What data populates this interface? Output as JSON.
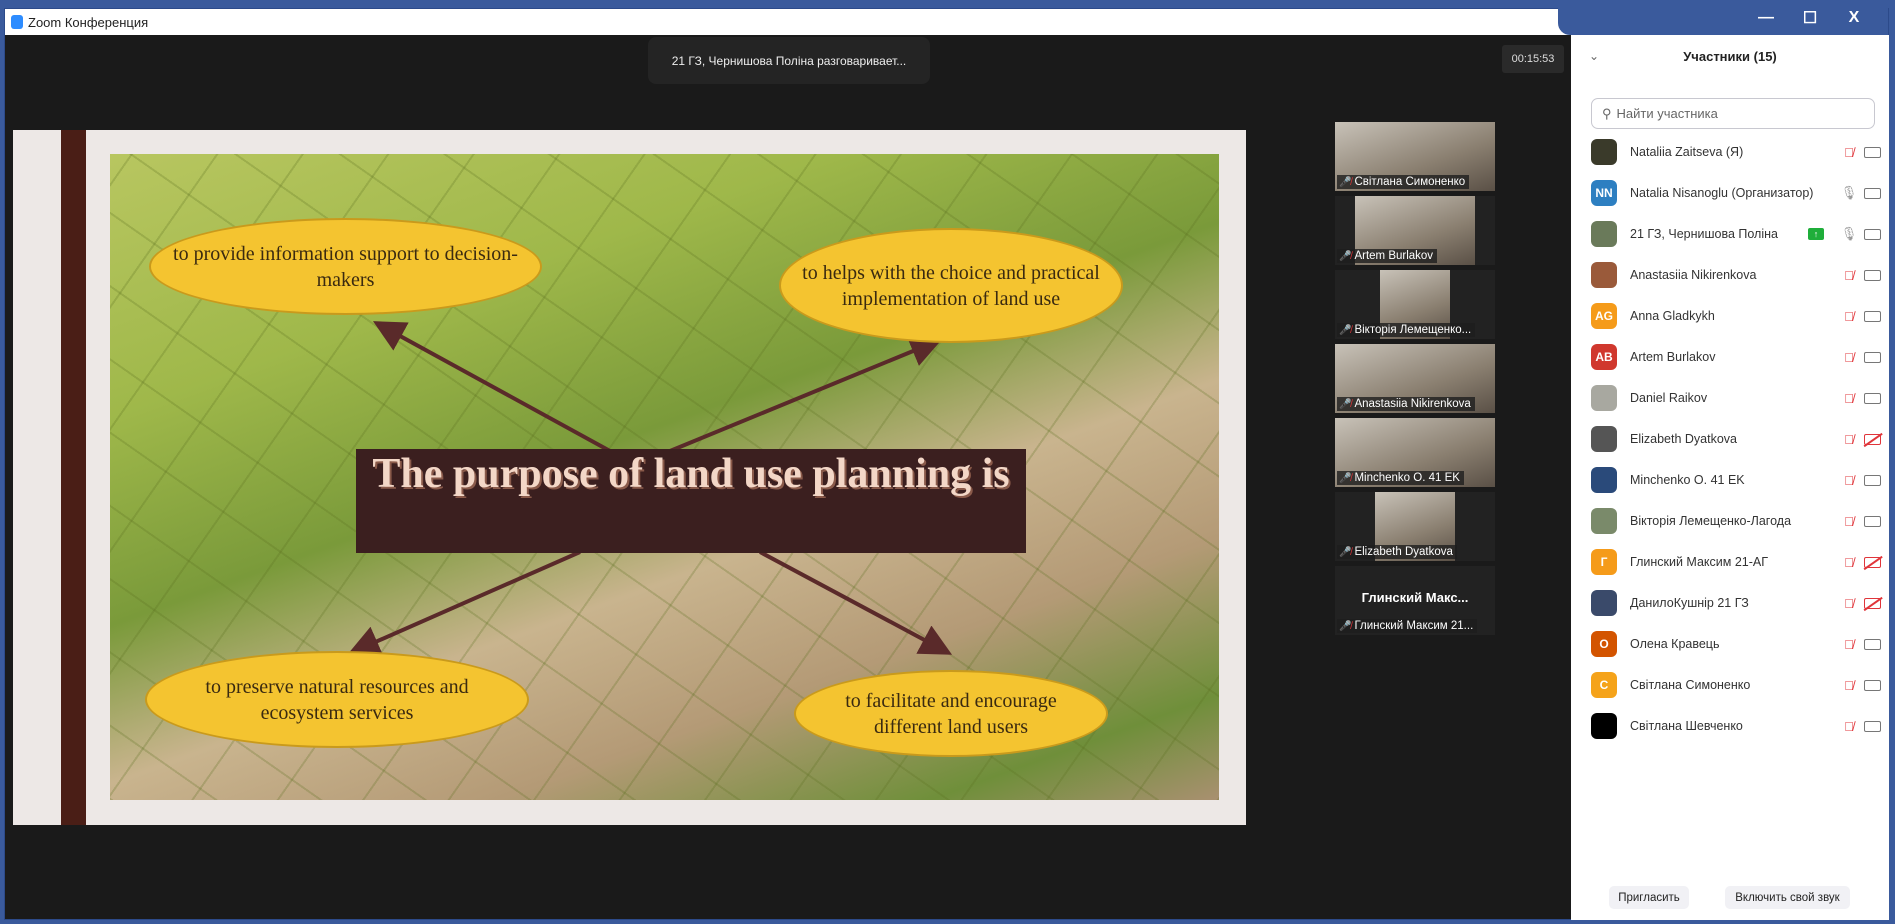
{
  "window": {
    "title": "Zoom Конференция",
    "minimize": "—",
    "maximize": "☐",
    "close": "X"
  },
  "meeting": {
    "speaking": "21 ГЗ, Чернишова Поліна разговаривает...",
    "timer": "00:15:53"
  },
  "slide": {
    "title": "The purpose of land use planning is",
    "bubbles": [
      "to provide information support to decision-makers",
      "to helps with the choice and practical implementation of land use",
      "to preserve natural resources and ecosystem services",
      "to facilitate and encourage different land users"
    ]
  },
  "videos": [
    {
      "name": "Світлана Симоненко"
    },
    {
      "name": "Artem Burlakov"
    },
    {
      "name": "Вікторія Лемещенко..."
    },
    {
      "name": "Anastasiia Nikirenkova"
    },
    {
      "name": "Minchenko O. 41 EK"
    },
    {
      "name": "Elizabeth Dyatkova"
    },
    {
      "name": "Глинский Максим 21...",
      "big": "Глинский  Макс..."
    }
  ],
  "panel": {
    "title": "Участники (15)",
    "search_placeholder": "Найти участника",
    "invite": "Пригласить",
    "unmute": "Включить свой звук",
    "participants": [
      {
        "name": "Nataliia Zaitseva (Я)",
        "initials": "",
        "color": "#3a3a2a",
        "mic": "off",
        "cam": "on"
      },
      {
        "name": "Natalia Nisanoglu (Организатор)",
        "initials": "NN",
        "color": "#2d7fc1",
        "mic": "on",
        "cam": "on"
      },
      {
        "name": "21 ГЗ, Чернишова Поліна",
        "initials": "",
        "color": "#6a7a5a",
        "mic": "on",
        "cam": "on",
        "sharing": true
      },
      {
        "name": "Anastasiia Nikirenkova",
        "initials": "",
        "color": "#9a5a3a",
        "mic": "off",
        "cam": "on"
      },
      {
        "name": "Anna Gladkykh",
        "initials": "AG",
        "color": "#f59b1a",
        "mic": "off",
        "cam": "on"
      },
      {
        "name": "Artem Burlakov",
        "initials": "AB",
        "color": "#d0382e",
        "mic": "off",
        "cam": "on"
      },
      {
        "name": "Daniel Raikov",
        "initials": "",
        "color": "#a8a8a0",
        "mic": "off",
        "cam": "on"
      },
      {
        "name": "Elizabeth Dyatkova",
        "initials": "",
        "color": "#555",
        "mic": "off",
        "cam": "off"
      },
      {
        "name": "Minchenko O. 41 EK",
        "initials": "",
        "color": "#2a4a7a",
        "mic": "off",
        "cam": "on"
      },
      {
        "name": "Вікторія Лемещенко-Лагода",
        "initials": "",
        "color": "#7a8a6a",
        "mic": "off",
        "cam": "on"
      },
      {
        "name": "Глинский Максим 21-АГ",
        "initials": "Г",
        "color": "#f59b1a",
        "mic": "off",
        "cam": "off"
      },
      {
        "name": "ДанилоКушнір 21 ГЗ",
        "initials": "",
        "color": "#3a4a6a",
        "mic": "off",
        "cam": "off"
      },
      {
        "name": "Олена Кравець",
        "initials": "О",
        "color": "#d35400",
        "mic": "off",
        "cam": "on"
      },
      {
        "name": "Світлана Симоненко",
        "initials": "С",
        "color": "#f5a31a",
        "mic": "off",
        "cam": "on"
      },
      {
        "name": "Світлана Шевченко",
        "initials": "",
        "color": "#000",
        "mic": "off",
        "cam": "on"
      }
    ]
  }
}
